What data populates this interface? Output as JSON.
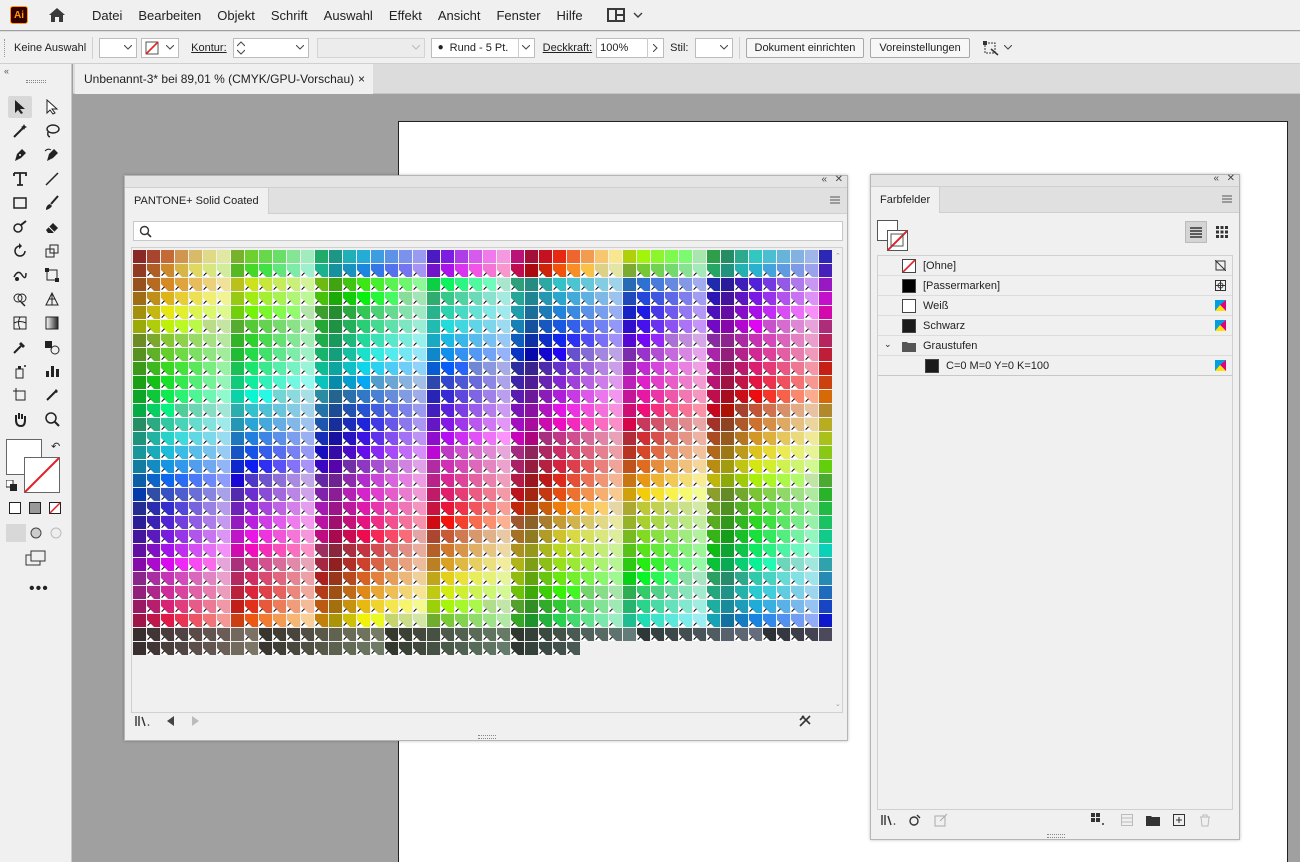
{
  "app": {
    "logo_text": "Ai"
  },
  "menu": [
    "Datei",
    "Bearbeiten",
    "Objekt",
    "Schrift",
    "Auswahl",
    "Effekt",
    "Ansicht",
    "Fenster",
    "Hilfe"
  ],
  "control_bar": {
    "selection_label": "Keine Auswahl",
    "stroke_label": "Kontur:",
    "stroke_value": "",
    "brush_value": "Rund - 5 Pt.",
    "opacity_label": "Deckkraft:",
    "opacity_value": "100%",
    "style_label": "Stil:",
    "doc_setup_button": "Dokument einrichten",
    "preferences_button": "Voreinstellungen"
  },
  "document_tab": {
    "title": "Unbenannt-3* bei 89,01 % (CMYK/GPU-Vorschau)",
    "close": "×"
  },
  "pantone_panel": {
    "tab_label": "PANTONE+ Solid Coated",
    "search_placeholder": "",
    "rows": 29,
    "cols": 50,
    "last_row_count": 32
  },
  "swatches_panel": {
    "tab_label": "Farbfelder",
    "items": [
      {
        "name": "[Ohne]",
        "chip": "none"
      },
      {
        "name": "[Passermarken]",
        "chip": "#000000"
      },
      {
        "name": "Weiß",
        "chip": "#ffffff"
      },
      {
        "name": "Schwarz",
        "chip": "#1a1a1a"
      }
    ],
    "group": {
      "name": "Graustufen",
      "items": [
        {
          "name": "C=0 M=0 Y=0 K=100",
          "chip": "#1a1a1a"
        }
      ]
    }
  },
  "colors": {
    "ui_bg": "#f0f0f0",
    "canvas_bg": "#a0a0a0",
    "accent_red": "#e0242a",
    "logo_orange": "#ff9a00"
  }
}
